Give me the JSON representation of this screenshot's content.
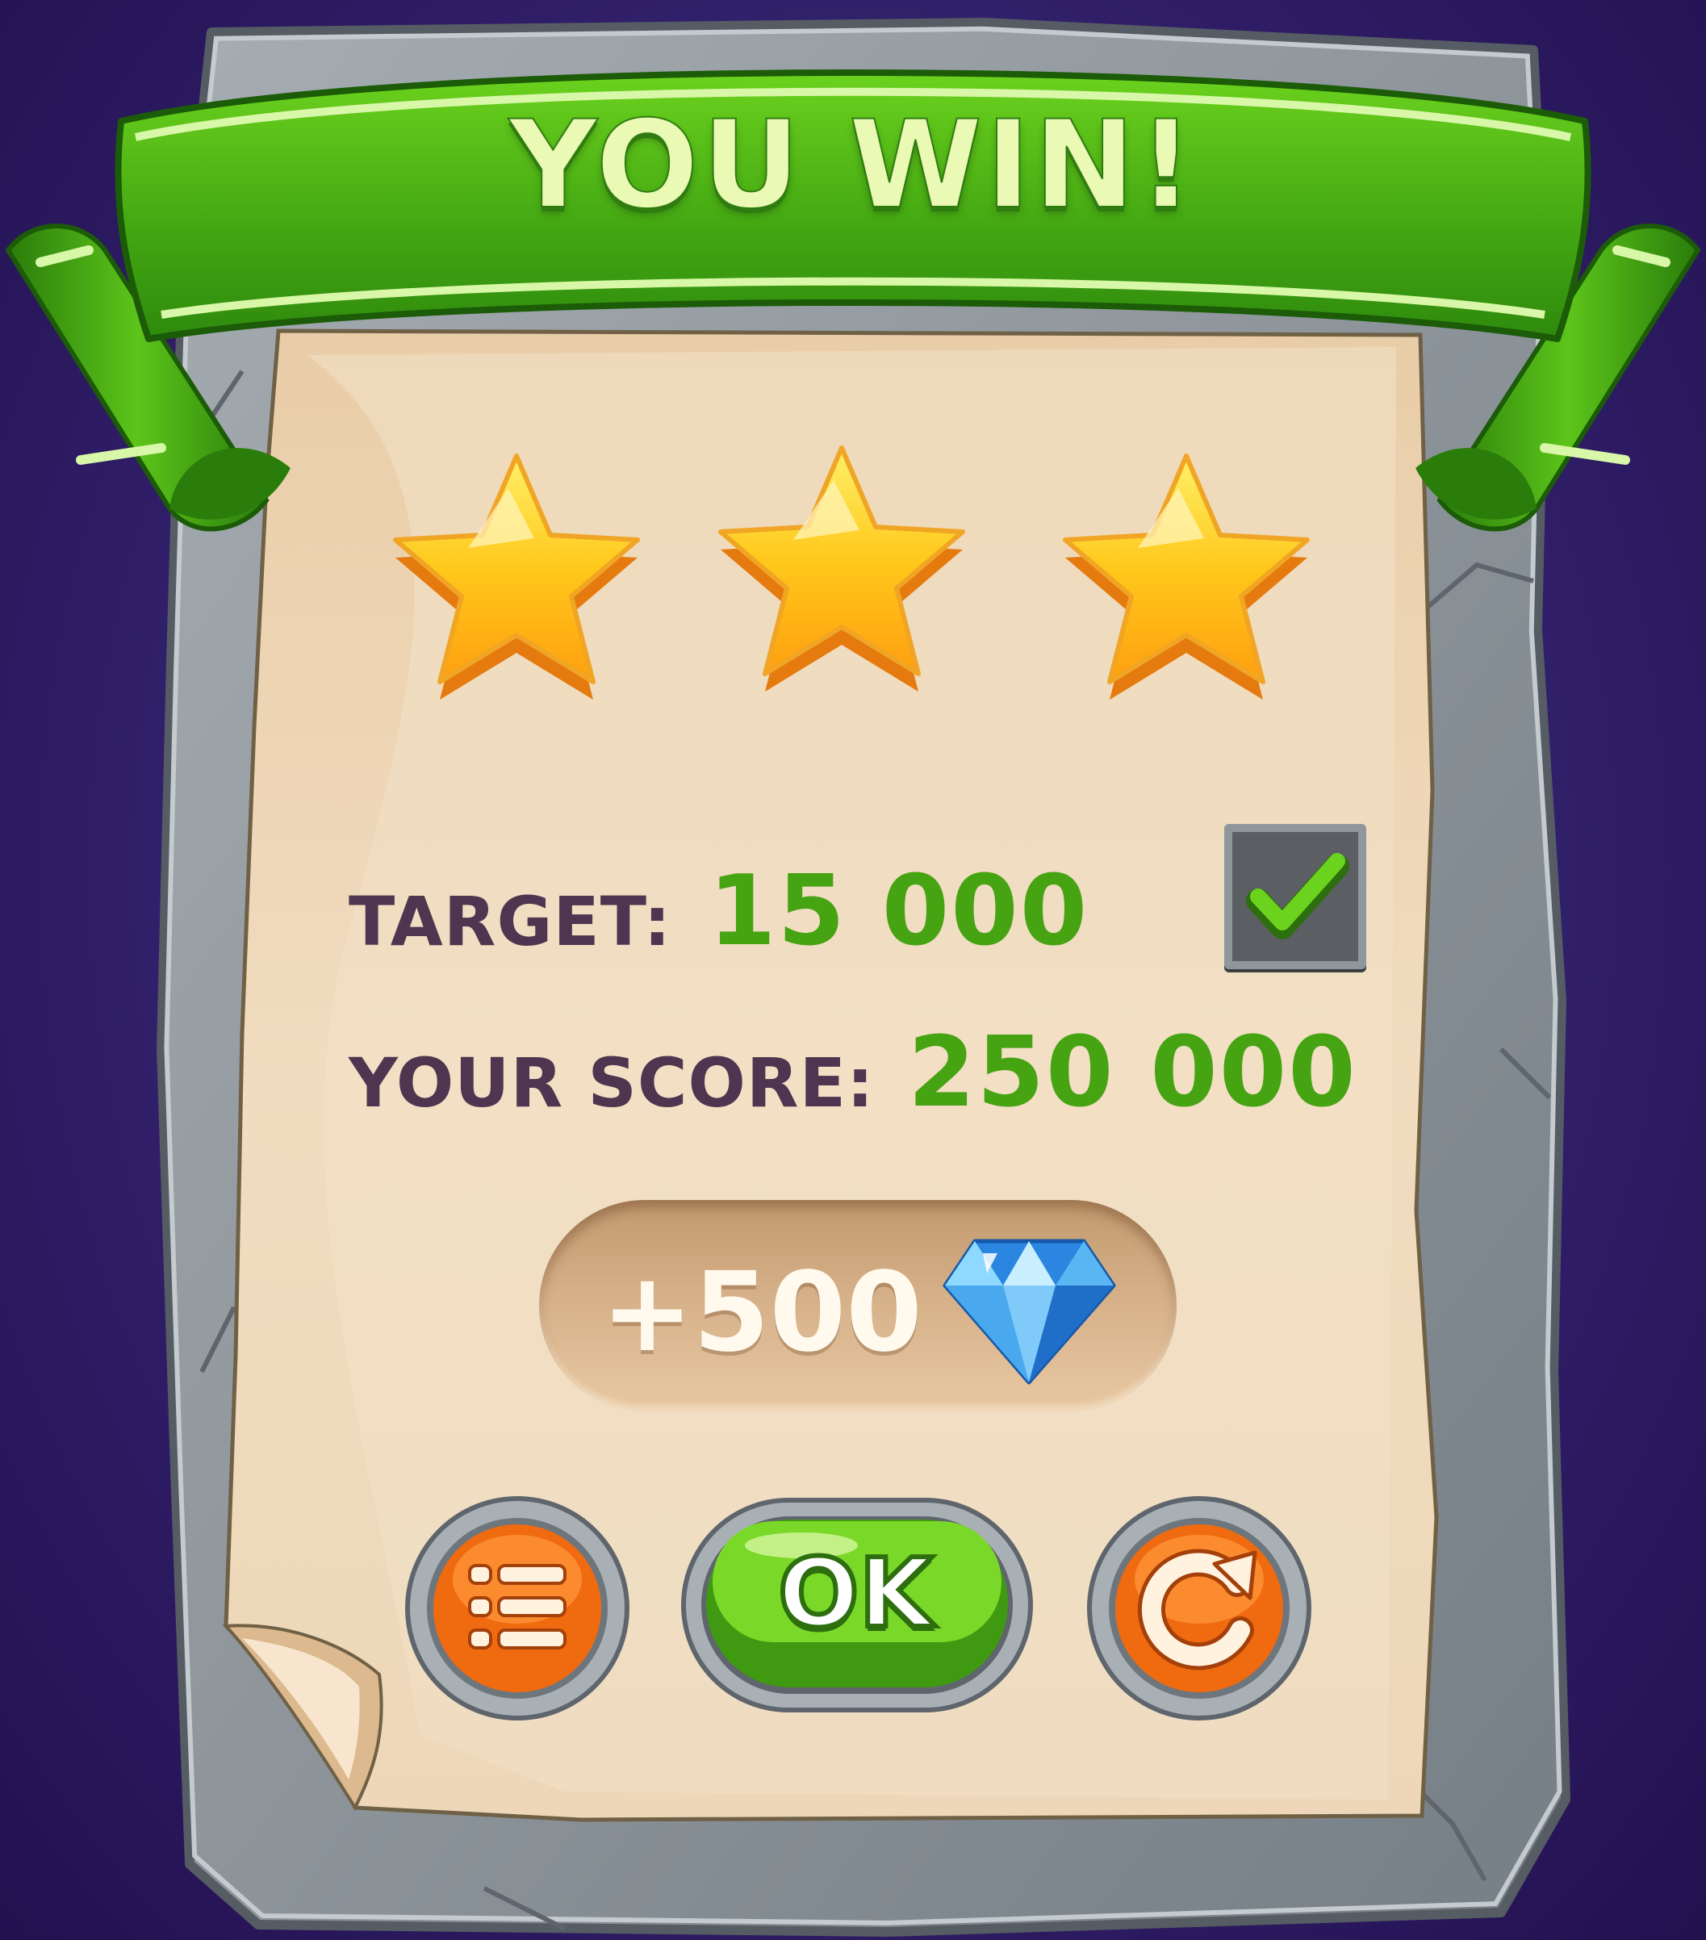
{
  "banner": {
    "title": "YOU WIN!"
  },
  "rating": {
    "stars_earned": 3,
    "stars_total": 3
  },
  "target": {
    "label": "TARGET:",
    "value": "15 000",
    "achieved": true
  },
  "score": {
    "label": "YOUR SCORE:",
    "value": "250 000"
  },
  "reward": {
    "amount": "+500",
    "currency_icon": "diamond-icon"
  },
  "buttons": {
    "menu_icon": "list-menu-icon",
    "ok_label": "OK",
    "replay_icon": "restart-icon"
  },
  "colors": {
    "background": "#2e1c66",
    "ribbon_green": "#46a312",
    "label_text": "#4e3550",
    "value_green": "#46a312",
    "star_gold": "#ffc21a",
    "button_orange": "#f06a10",
    "parchment": "#efd9bb",
    "stone_frame": "#8c959c"
  }
}
